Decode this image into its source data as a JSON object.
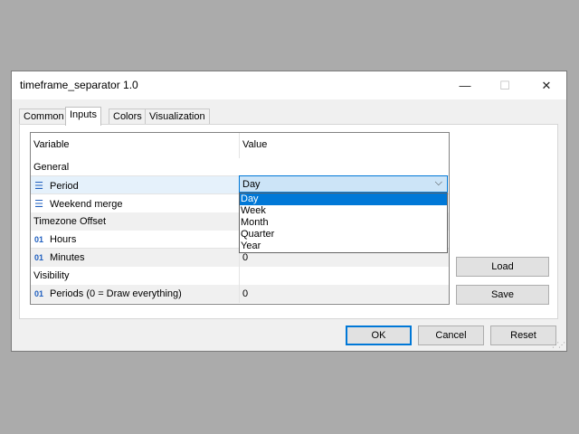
{
  "window": {
    "title": "timeframe_separator 1.0",
    "minimize_glyph": "—",
    "maximize_glyph": "☐",
    "close_glyph": "✕"
  },
  "tabs": [
    {
      "label": "Common",
      "active": false
    },
    {
      "label": "Inputs",
      "active": true
    },
    {
      "label": "Colors",
      "active": false
    },
    {
      "label": "Visualization",
      "active": false
    }
  ],
  "grid": {
    "headers": {
      "variable": "Variable",
      "value": "Value"
    },
    "rows": [
      {
        "type": "section",
        "variable": "General",
        "value": ""
      },
      {
        "type": "enum",
        "icon": "enum-icon",
        "variable": "Period",
        "value": "Day"
      },
      {
        "type": "enum",
        "icon": "enum-icon",
        "variable": "Weekend merge",
        "value": ""
      },
      {
        "type": "section",
        "variable": "Timezone Offset",
        "value": ""
      },
      {
        "type": "int",
        "icon": "int-icon",
        "variable": "Hours",
        "value": ""
      },
      {
        "type": "int",
        "icon": "int-icon",
        "variable": "Minutes",
        "value": "0"
      },
      {
        "type": "section",
        "variable": "Visibility",
        "value": ""
      },
      {
        "type": "int",
        "icon": "int-icon",
        "variable": "Periods (0 = Draw everything)",
        "value": "0"
      }
    ],
    "int_icon_text": "01",
    "enum_icon_text": "☰"
  },
  "period_dropdown": {
    "selected": "Day",
    "arrow": "⌵",
    "options": [
      "Day",
      "Week",
      "Month",
      "Quarter",
      "Year"
    ],
    "highlighted_index": 0
  },
  "side_buttons": {
    "load": "Load",
    "save": "Save"
  },
  "footer_buttons": {
    "ok": "OK",
    "cancel": "Cancel",
    "reset": "Reset"
  },
  "colors": {
    "accent": "#0078d7",
    "background": "#ababab",
    "dialog": "#f0f0f0"
  }
}
